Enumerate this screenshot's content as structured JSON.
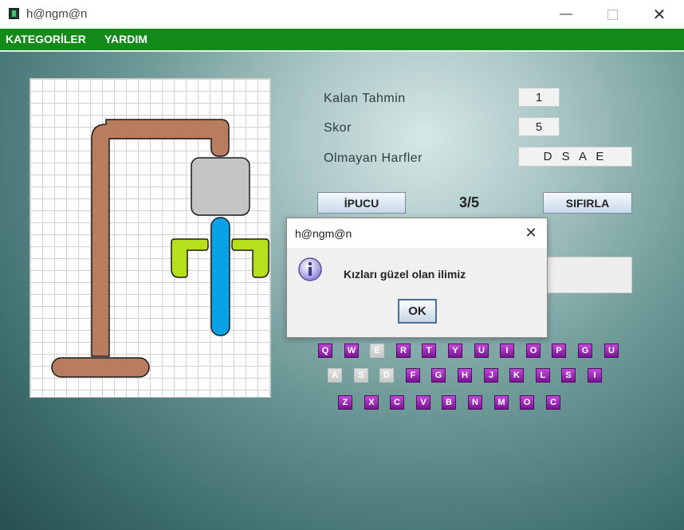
{
  "window": {
    "title": "h@ngm@n",
    "controls": [
      "minimize-icon",
      "maximize-icon",
      "close-icon"
    ]
  },
  "menu": {
    "items": [
      {
        "label": "KATEGORİLER"
      },
      {
        "label": "YARDIM"
      }
    ]
  },
  "stats": {
    "remaining_label": "Kalan Tahmin",
    "remaining_value": "1",
    "score_label": "Skor",
    "score_value": "5",
    "missing_label": "Olmayan Harfler",
    "missing_value": "D S A E"
  },
  "controls": {
    "hint_label": "İPUCU",
    "counter": "3/5",
    "reset_label": "SIFIRLA"
  },
  "keyboard": {
    "rows": [
      [
        {
          "letter": "Q",
          "enabled": true
        },
        {
          "letter": "W",
          "enabled": true
        },
        {
          "letter": "E",
          "enabled": false
        },
        {
          "letter": "R",
          "enabled": true
        },
        {
          "letter": "T",
          "enabled": true
        },
        {
          "letter": "Y",
          "enabled": true
        },
        {
          "letter": "U",
          "enabled": true
        },
        {
          "letter": "I",
          "enabled": true
        },
        {
          "letter": "O",
          "enabled": true
        },
        {
          "letter": "P",
          "enabled": true
        },
        {
          "letter": "G",
          "enabled": true
        },
        {
          "letter": "U",
          "enabled": true
        }
      ],
      [
        {
          "letter": "A",
          "enabled": false
        },
        {
          "letter": "S",
          "enabled": false
        },
        {
          "letter": "D",
          "enabled": false
        },
        {
          "letter": "F",
          "enabled": true
        },
        {
          "letter": "G",
          "enabled": true
        },
        {
          "letter": "H",
          "enabled": true
        },
        {
          "letter": "J",
          "enabled": true
        },
        {
          "letter": "K",
          "enabled": true
        },
        {
          "letter": "L",
          "enabled": true
        },
        {
          "letter": "S",
          "enabled": true
        },
        {
          "letter": "I",
          "enabled": true
        }
      ],
      [
        {
          "letter": "Z",
          "enabled": true
        },
        {
          "letter": "X",
          "enabled": true
        },
        {
          "letter": "C",
          "enabled": true
        },
        {
          "letter": "V",
          "enabled": true
        },
        {
          "letter": "B",
          "enabled": true
        },
        {
          "letter": "N",
          "enabled": true
        },
        {
          "letter": "M",
          "enabled": true
        },
        {
          "letter": "O",
          "enabled": true
        },
        {
          "letter": "C",
          "enabled": true
        }
      ]
    ]
  },
  "dialog": {
    "title": "h@ngm@n",
    "icon": "info-icon",
    "message": "Kızları güzel olan ilimiz",
    "ok_label": "OK"
  },
  "colors": {
    "menubar": "#148a1a",
    "gallows": "#b87c5e",
    "head": "#c4c4c4",
    "arms": "#b6e01c",
    "body": "#0aa2e6",
    "key": "#9c2ab8"
  }
}
